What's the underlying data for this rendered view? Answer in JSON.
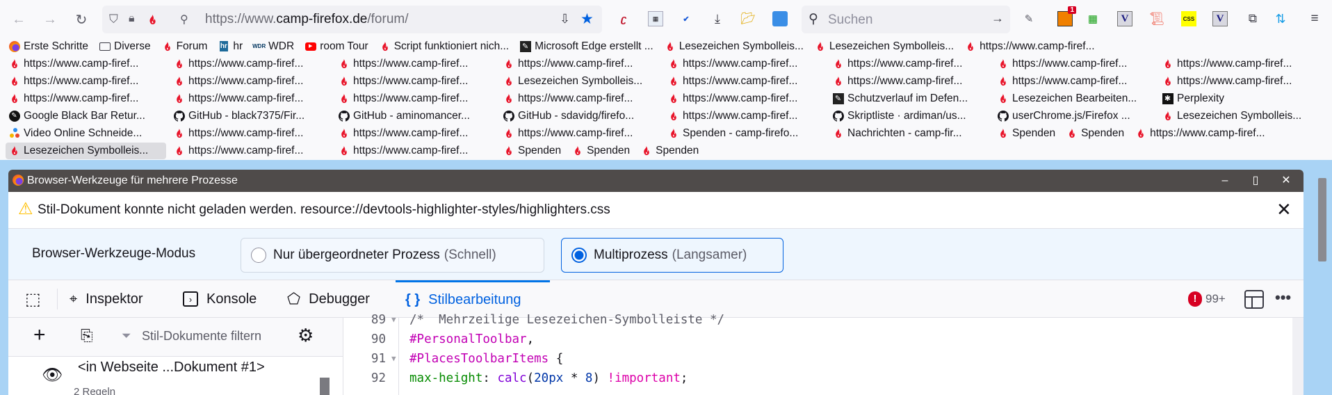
{
  "nav": {
    "url_prefix": "https://www.",
    "url_domain": "camp-firefox.de",
    "url_path": "/forum/",
    "search_placeholder": "Suchen",
    "badge": "1"
  },
  "bookmarks": [
    [
      {
        "label": "Erste Schritte",
        "icon": "firefox"
      },
      {
        "label": "Diverse",
        "icon": "folder"
      },
      {
        "label": "Forum",
        "icon": "flame"
      },
      {
        "label": "hr",
        "icon": "hr"
      },
      {
        "label": "WDR",
        "icon": "wdr"
      },
      {
        "label": "room Tour",
        "icon": "youtube"
      },
      {
        "label": "Script funktioniert nich...",
        "icon": "flame"
      },
      {
        "label": "Microsoft Edge erstellt ...",
        "icon": "pen"
      },
      {
        "label": "Lesezeichen Symbolleis...",
        "icon": "flame"
      },
      {
        "label": "Lesezeichen Symbolleis...",
        "icon": "flame"
      },
      {
        "label": "https://www.camp-firef...",
        "icon": "flame"
      }
    ],
    [
      {
        "label": "https://www.camp-firef...",
        "icon": "flame"
      },
      {
        "label": "https://www.camp-firef...",
        "icon": "flame"
      },
      {
        "label": "https://www.camp-firef...",
        "icon": "flame"
      },
      {
        "label": "https://www.camp-firef...",
        "icon": "flame"
      },
      {
        "label": "https://www.camp-firef...",
        "icon": "flame"
      },
      {
        "label": "https://www.camp-firef...",
        "icon": "flame"
      },
      {
        "label": "https://www.camp-firef...",
        "icon": "flame"
      },
      {
        "label": "https://www.camp-firef...",
        "icon": "flame"
      }
    ],
    [
      {
        "label": "https://www.camp-firef...",
        "icon": "flame"
      },
      {
        "label": "https://www.camp-firef...",
        "icon": "flame"
      },
      {
        "label": "https://www.camp-firef...",
        "icon": "flame"
      },
      {
        "label": "Lesezeichen Symbolleis...",
        "icon": "flame"
      },
      {
        "label": "https://www.camp-firef...",
        "icon": "flame"
      },
      {
        "label": "https://www.camp-firef...",
        "icon": "flame"
      },
      {
        "label": "https://www.camp-firef...",
        "icon": "flame"
      },
      {
        "label": "https://www.camp-firef...",
        "icon": "flame"
      }
    ],
    [
      {
        "label": "https://www.camp-firef...",
        "icon": "flame"
      },
      {
        "label": "https://www.camp-firef...",
        "icon": "flame"
      },
      {
        "label": "https://www.camp-firef...",
        "icon": "flame"
      },
      {
        "label": "https://www.camp-firef...",
        "icon": "flame"
      },
      {
        "label": "https://www.camp-firef...",
        "icon": "flame"
      },
      {
        "label": "Schutzverlauf im Defen...",
        "icon": "pen"
      },
      {
        "label": "Lesezeichen Bearbeiten...",
        "icon": "flame"
      },
      {
        "label": "Perplexity",
        "icon": "perplexity"
      }
    ],
    [
      {
        "label": "Google Black Bar Retur...",
        "icon": "dark"
      },
      {
        "label": "GitHub - black7375/Fir...",
        "icon": "github"
      },
      {
        "label": "GitHub - aminomancer...",
        "icon": "github"
      },
      {
        "label": "GitHub - sdavidg/firefo...",
        "icon": "github"
      },
      {
        "label": "https://www.camp-firef...",
        "icon": "flame"
      },
      {
        "label": "Skriptliste · ardiman/us...",
        "icon": "github"
      },
      {
        "label": "userChrome.js/Firefox ...",
        "icon": "github"
      },
      {
        "label": "Lesezeichen Symbolleis...",
        "icon": "flame"
      }
    ],
    [
      {
        "label": "Video Online Schneide...",
        "icon": "dots"
      },
      {
        "label": "https://www.camp-firef...",
        "icon": "flame"
      },
      {
        "label": "https://www.camp-firef...",
        "icon": "flame"
      },
      {
        "label": "https://www.camp-firef...",
        "icon": "flame"
      },
      {
        "label": "Spenden - camp-firefo...",
        "icon": "flame"
      },
      {
        "label": "Nachrichten - camp-fir...",
        "icon": "flame"
      },
      {
        "label": "Spenden",
        "icon": "flame"
      },
      {
        "label": "Spenden",
        "icon": "flame"
      },
      {
        "label": "https://www.camp-firef...",
        "icon": "flame"
      }
    ],
    [
      {
        "label": "Lesezeichen Symbolleis...",
        "icon": "flame",
        "selected": true
      },
      {
        "label": "https://www.camp-firef...",
        "icon": "flame"
      },
      {
        "label": "https://www.camp-firef...",
        "icon": "flame"
      },
      {
        "label": "Spenden",
        "icon": "flame"
      },
      {
        "label": "Spenden",
        "icon": "flame"
      },
      {
        "label": "Spenden",
        "icon": "flame"
      }
    ]
  ],
  "devtools": {
    "title": "Browser-Werkzeuge für mehrere Prozesse",
    "notification": "Stil-Dokument konnte nicht geladen werden. resource://devtools-highlighter-styles/highlighters.css",
    "mode_label": "Browser-Werkzeuge-Modus",
    "mode_options": [
      {
        "label": "Nur übergeordneter Prozess",
        "sub": "(Schnell)",
        "selected": false
      },
      {
        "label": "Multiprozess",
        "sub": "(Langsamer)",
        "selected": true
      }
    ],
    "tabs": {
      "inspector": "Inspektor",
      "console": "Konsole",
      "debugger": "Debugger",
      "style_editor": "Stilbearbeitung"
    },
    "error_count": "99+",
    "filter_placeholder": "Stil-Dokumente filtern",
    "stylesheet": {
      "name": "<in Webseite ...Dokument #1>",
      "rules": "2 Regeln"
    },
    "code_lines": [
      {
        "n": "89",
        "fold": true,
        "tokens": [
          [
            "c-com",
            "/*  Mehrzeilige Lesezeichen-Symbolleiste */"
          ]
        ]
      },
      {
        "n": "90",
        "fold": false,
        "tokens": [
          [
            "c-sel",
            "#PersonalToolbar"
          ],
          [
            "",
            ","
          ]
        ]
      },
      {
        "n": "91",
        "fold": true,
        "tokens": [
          [
            "c-sel",
            "#PlacesToolbarItems"
          ],
          [
            "",
            " {"
          ]
        ]
      },
      {
        "n": "92",
        "fold": false,
        "tokens": [
          [
            "c-prop",
            "max-height"
          ],
          [
            "",
            ": "
          ],
          [
            "c-fn",
            "calc"
          ],
          [
            "",
            "("
          ],
          [
            "c-num",
            "20px"
          ],
          [
            "",
            " * "
          ],
          [
            "c-num",
            "8"
          ],
          [
            "",
            ") "
          ],
          [
            "c-imp",
            "!important"
          ],
          [
            "",
            ";"
          ]
        ]
      }
    ]
  },
  "colors": {
    "accent": "#0061e0",
    "flame": "#e8142a",
    "titlebar": "#4f4b4a"
  }
}
